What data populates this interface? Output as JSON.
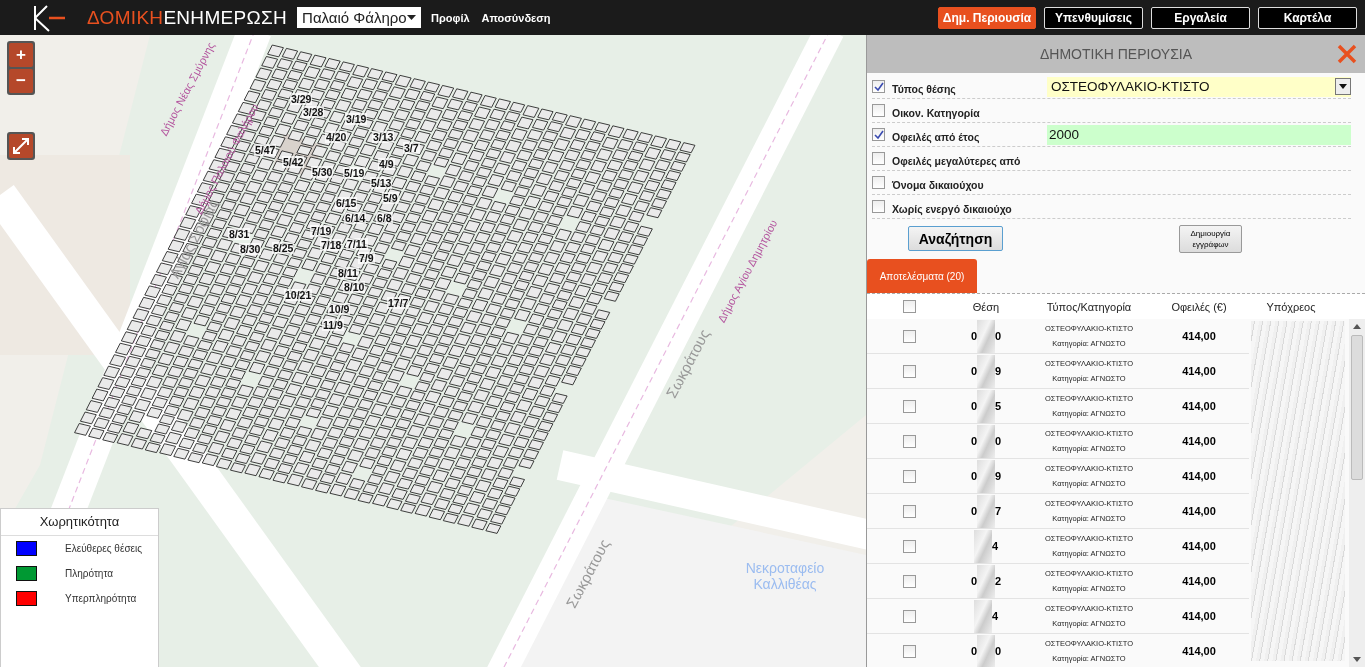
{
  "header": {
    "logo_bold": "ΔΟΜΙΚΗ",
    "logo_light": "ΕΝΗΜΕΡΩΣΗ",
    "municipality": "Παλαιό Φάληρο",
    "links": [
      "Προφίλ",
      "Αποσύνδεση"
    ],
    "nav": [
      {
        "label": "Δημ. Περιουσία",
        "selected": true
      },
      {
        "label": "Υπενθυμίσεις",
        "selected": false
      },
      {
        "label": "Εργαλεία",
        "selected": false
      },
      {
        "label": "Καρτέλα",
        "selected": false
      }
    ]
  },
  "map": {
    "zoom_in": "+",
    "zoom_out": "−",
    "plot_labels": [
      "3/29",
      "3/28",
      "3/19",
      "4/20",
      "3/13",
      "3/7",
      "5/47",
      "5/42",
      "4/9",
      "5/30",
      "5/19",
      "5/13",
      "5/9",
      "6/15",
      "6/14",
      "6/8",
      "7/19",
      "8/31",
      "7/18",
      "7/11",
      "8/30",
      "8/25",
      "7/9",
      "8/11",
      "8/10",
      "10/21",
      "17/7",
      "10/9",
      "11/9"
    ],
    "street_labels": [
      {
        "text": "Αγίας Σοφίας",
        "kind": "street"
      },
      {
        "text": "Δήμος Νέας Σμύρνης",
        "kind": "boundary"
      },
      {
        "text": "Δήμος Παλαιού Φαλήρου",
        "kind": "boundary"
      },
      {
        "text": "Σωκράτους",
        "kind": "street"
      },
      {
        "text": "Δήμος Αγίου Δημητρίου",
        "kind": "boundary"
      },
      {
        "text": "Σωκράτους",
        "kind": "street"
      },
      {
        "text": "Νεκροταφείο Καλλιθέας",
        "kind": "place"
      }
    ],
    "legend": {
      "title": "Χωρητικότητα",
      "items": [
        {
          "label": "Ελεύθερες θέσεις",
          "color": "#0000ff"
        },
        {
          "label": "Πληρότητα",
          "color": "#009933"
        },
        {
          "label": "Υπερπληρότητα",
          "color": "#ff0000"
        }
      ]
    }
  },
  "panel": {
    "title": "ΔΗΜΟΤΙΚΗ ΠΕΡΙΟΥΣΙΑ",
    "filters": [
      {
        "label": "Τύπος θέσης",
        "checked": true,
        "kind": "select",
        "value": "ΟΣΤΕΟΦΥΛΑΚΙΟ-ΚΤΙΣΤΟ"
      },
      {
        "label": "Οικον. Κατηγορία",
        "checked": false,
        "kind": "empty"
      },
      {
        "label": "Οφειλές από έτος",
        "checked": true,
        "kind": "text",
        "value": "2000"
      },
      {
        "label": "Οφειλές μεγαλύτερες από",
        "checked": false,
        "kind": "empty"
      },
      {
        "label": "Όνομα δικαιούχου",
        "checked": false,
        "kind": "empty"
      },
      {
        "label": "Χωρίς ενεργό δικαιούχο",
        "checked": false,
        "kind": "empty"
      }
    ],
    "search_button": "Αναζήτηση",
    "documents_button": "Δημιουργία εγγράφων",
    "results_tab": {
      "label": "Αποτελέσματα (20)",
      "selected": true
    },
    "table": {
      "select_all": false,
      "columns": [
        "Θέση",
        "Τύπος/Κατηγορία",
        "Οφειλές (€)",
        "Υπόχρεος"
      ],
      "rows": [
        {
          "checked": false,
          "position_start": "0",
          "position_end": "0",
          "type": "ΟΣΤΕΟΦΥΛΑΚΙΟ-ΚΤΙΣΤΟ",
          "category": "Κατηγορία: ΑΓΝΩΣΤΟ",
          "amount": "414,00"
        },
        {
          "checked": false,
          "position_start": "0",
          "position_end": "9",
          "type": "ΟΣΤΕΟΦΥΛΑΚΙΟ-ΚΤΙΣΤΟ",
          "category": "Κατηγορία: ΑΓΝΩΣΤΟ",
          "amount": "414,00"
        },
        {
          "checked": false,
          "position_start": "0",
          "position_end": "5",
          "type": "ΟΣΤΕΟΦΥΛΑΚΙΟ-ΚΤΙΣΤΟ",
          "category": "Κατηγορία: ΑΓΝΩΣΤΟ",
          "amount": "414,00"
        },
        {
          "checked": false,
          "position_start": "0",
          "position_end": "0",
          "type": "ΟΣΤΕΟΦΥΛΑΚΙΟ-ΚΤΙΣΤΟ",
          "category": "Κατηγορία: ΑΓΝΩΣΤΟ",
          "amount": "414,00"
        },
        {
          "checked": false,
          "position_start": "0",
          "position_end": "9",
          "type": "ΟΣΤΕΟΦΥΛΑΚΙΟ-ΚΤΙΣΤΟ",
          "category": "Κατηγορία: ΑΓΝΩΣΤΟ",
          "amount": "414,00"
        },
        {
          "checked": false,
          "position_start": "0",
          "position_end": "7",
          "type": "ΟΣΤΕΟΦΥΛΑΚΙΟ-ΚΤΙΣΤΟ",
          "category": "Κατηγορία: ΑΓΝΩΣΤΟ",
          "amount": "414,00"
        },
        {
          "checked": false,
          "position_end": "4",
          "type": "ΟΣΤΕΟΦΥΛΑΚΙΟ-ΚΤΙΣΤΟ",
          "category": "Κατηγορία: ΑΓΝΩΣΤΟ",
          "amount": "414,00"
        },
        {
          "checked": false,
          "position_start": "0",
          "position_end": "2",
          "type": "ΟΣΤΕΟΦΥΛΑΚΙΟ-ΚΤΙΣΤΟ",
          "category": "Κατηγορία: ΑΓΝΩΣΤΟ",
          "amount": "414,00"
        },
        {
          "checked": false,
          "position_end": "4",
          "type": "ΟΣΤΕΟΦΥΛΑΚΙΟ-ΚΤΙΣΤΟ",
          "category": "Κατηγορία: ΑΓΝΩΣΤΟ",
          "amount": "414,00"
        },
        {
          "checked": false,
          "position_start": "0",
          "position_end": "0",
          "type": "ΟΣΤΕΟΦΥΛΑΚΙΟ-ΚΤΙΣΤΟ",
          "category": "Κατηγορία: ΑΓΝΩΣΤΟ",
          "amount": "414,00"
        }
      ]
    }
  }
}
